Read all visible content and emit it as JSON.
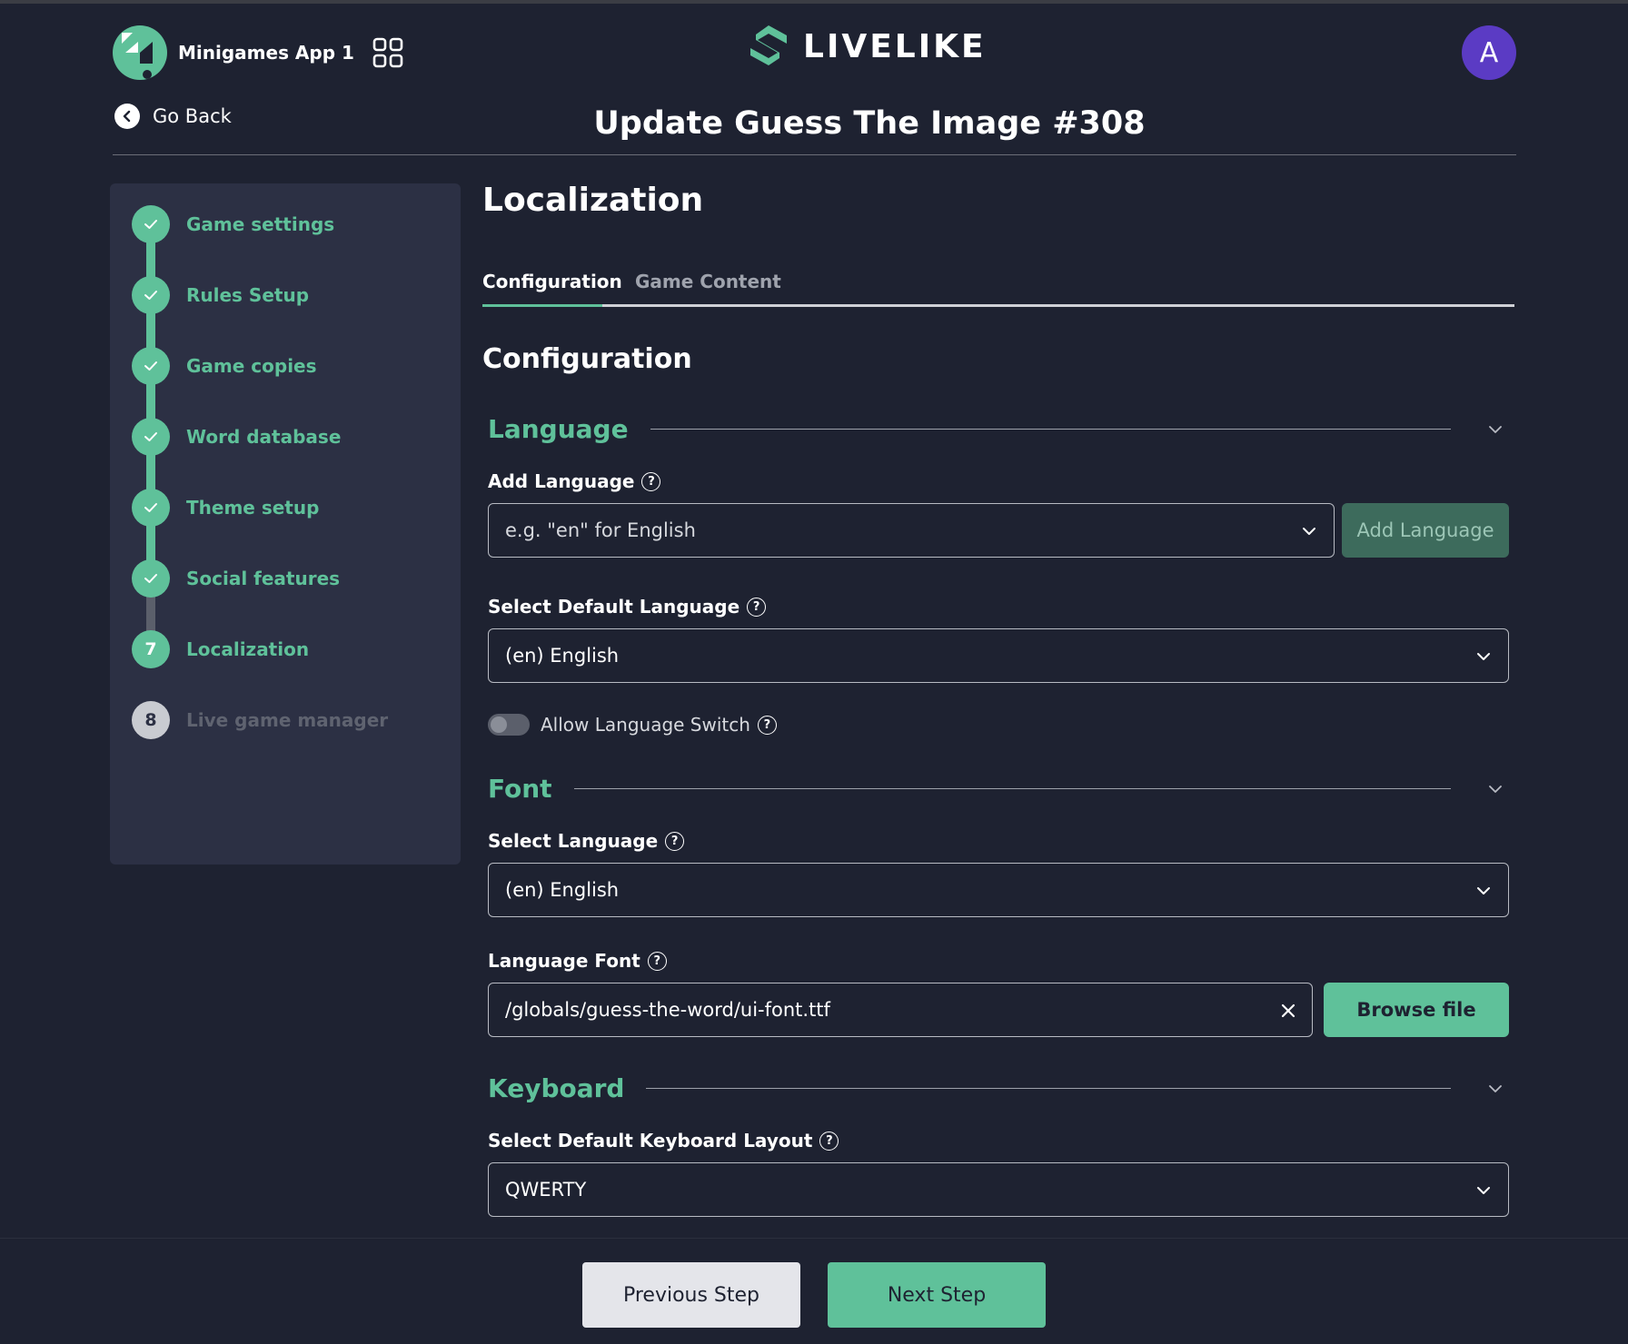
{
  "header": {
    "app_name": "Minigames App 1",
    "brand": "LIVELIKE",
    "avatar_initial": "A",
    "go_back": "Go Back",
    "page_title": "Update Guess The Image #308"
  },
  "sidebar": {
    "steps": [
      {
        "number": "1",
        "label": "Game settings",
        "status": "done"
      },
      {
        "number": "2",
        "label": "Rules Setup",
        "status": "done"
      },
      {
        "number": "3",
        "label": "Game copies",
        "status": "done"
      },
      {
        "number": "4",
        "label": "Word database",
        "status": "done"
      },
      {
        "number": "5",
        "label": "Theme setup",
        "status": "done"
      },
      {
        "number": "6",
        "label": "Social features",
        "status": "done"
      },
      {
        "number": "7",
        "label": "Localization",
        "status": "current"
      },
      {
        "number": "8",
        "label": "Live game manager",
        "status": "pending"
      }
    ]
  },
  "main": {
    "title": "Localization",
    "tabs": [
      {
        "label": "Configuration",
        "active": true
      },
      {
        "label": "Game Content",
        "active": false
      }
    ],
    "config_title": "Configuration",
    "language": {
      "title": "Language",
      "add_language_label": "Add Language",
      "add_language_placeholder": "e.g. \"en\" for English",
      "add_language_button": "Add Language",
      "default_language_label": "Select Default Language",
      "default_language_value": "(en) English",
      "allow_switch_label": "Allow Language Switch",
      "allow_switch_enabled": false
    },
    "font": {
      "title": "Font",
      "select_language_label": "Select Language",
      "select_language_value": "(en) English",
      "language_font_label": "Language Font",
      "language_font_value": "/globals/guess-the-word/ui-font.ttf",
      "browse_button": "Browse file"
    },
    "keyboard": {
      "title": "Keyboard",
      "layout_label": "Select Default Keyboard Layout",
      "layout_value": "QWERTY"
    }
  },
  "footer": {
    "previous": "Previous Step",
    "next": "Next Step"
  },
  "colors": {
    "accent": "#5fc19a",
    "background": "#1e2231",
    "sidebar": "#2c3044",
    "avatar": "#5b3bc4"
  }
}
